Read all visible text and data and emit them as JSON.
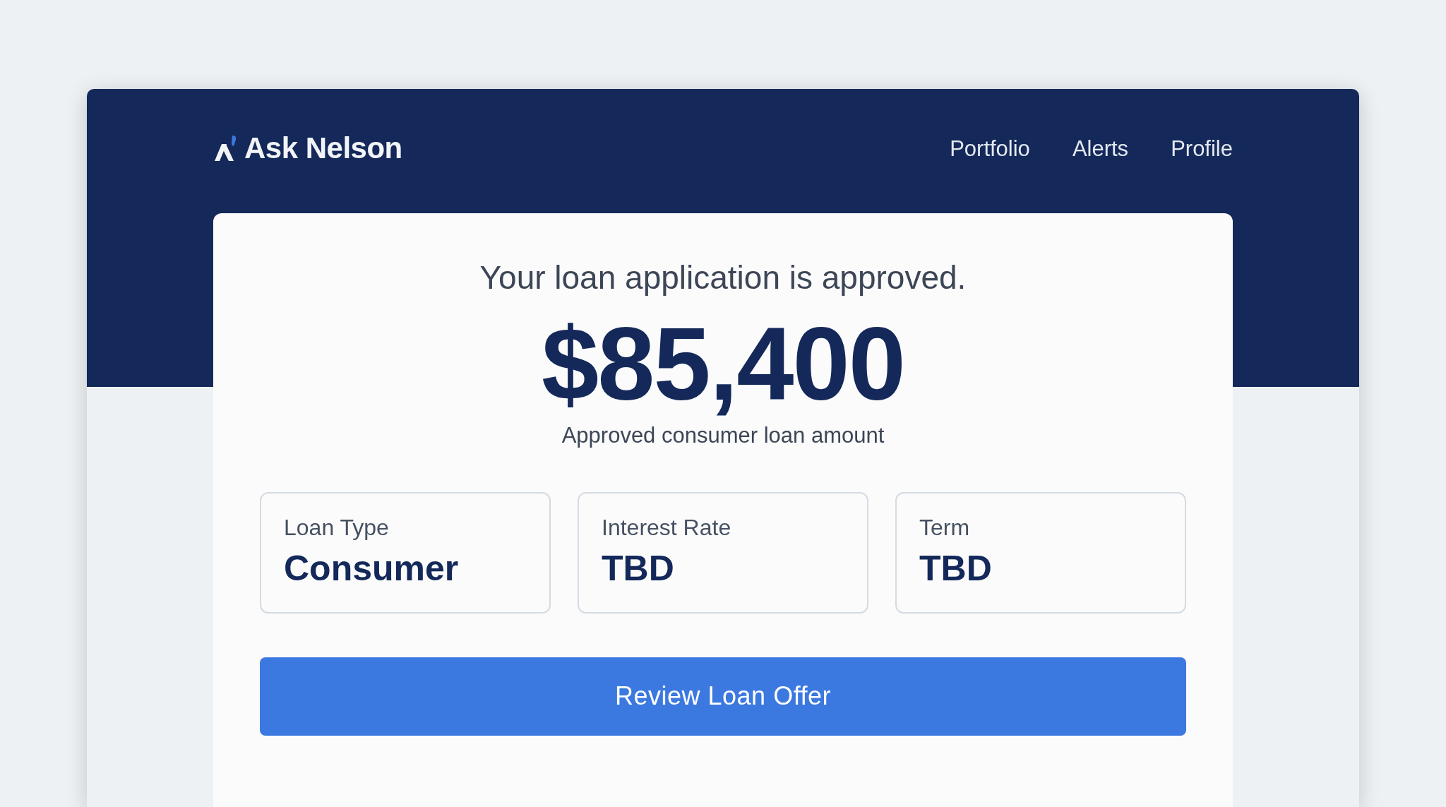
{
  "brand": {
    "name": "Ask Nelson"
  },
  "nav": [
    {
      "label": "Portfolio"
    },
    {
      "label": "Alerts"
    },
    {
      "label": "Profile"
    }
  ],
  "approval": {
    "headline": "Your loan application is approved.",
    "amount": "$85,400",
    "caption": "Approved consumer loan amount"
  },
  "details": [
    {
      "label": "Loan Type",
      "value": "Consumer"
    },
    {
      "label": "Interest Rate",
      "value": "TBD"
    },
    {
      "label": "Term",
      "value": "TBD"
    }
  ],
  "action": {
    "label": "Review Loan Offer"
  }
}
